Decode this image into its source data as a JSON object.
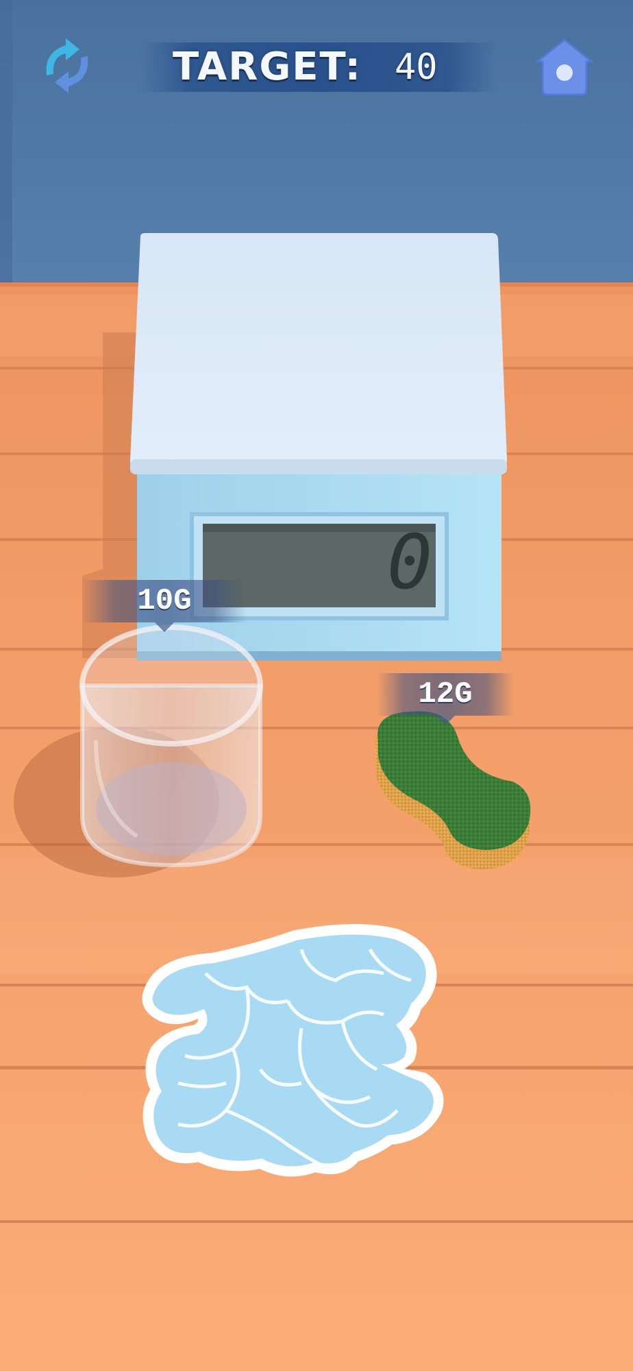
{
  "hud": {
    "target_label": "TARGET:",
    "target_value": "40",
    "restart_icon": "refresh-arrows-icon",
    "home_icon": "home-icon"
  },
  "scale": {
    "display_value": "0"
  },
  "items": {
    "cup": {
      "weight_label": "10G"
    },
    "sponge": {
      "weight_label": "12G"
    }
  },
  "colors": {
    "wall": "#4f79a6",
    "table": "#f5a06a",
    "scale_body": "#aee0f4",
    "scale_top": "#dbeaf7",
    "display": "#5c6664",
    "sponge_green": "#3a7a38",
    "sponge_foam": "#e0a64c",
    "ice": "#aeddf5",
    "accent": "#3fb6e4"
  }
}
